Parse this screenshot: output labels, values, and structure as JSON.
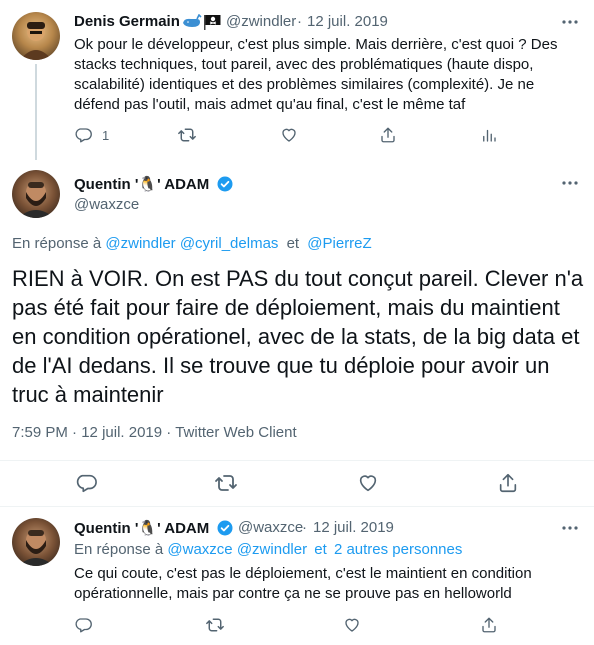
{
  "tweet1": {
    "name": "Denis Germain",
    "handle": "@zwindler",
    "date": "12 juil. 2019",
    "sep": "·",
    "text": "Ok pour le développeur, c'est plus simple. Mais derrière, c'est quoi ? Des stacks techniques, tout pareil, avec des problématiques (haute dispo, scalabilité) identiques et des problèmes similaires (complexité). Je ne défend pas l'outil, mais admet qu'au final, c'est le même taf",
    "reply_count": "1"
  },
  "tweet2": {
    "name": "Quentin '🐧' ADAM",
    "handle": "@waxzce",
    "reply_prefix": "En réponse à",
    "reply_to_1": "@zwindler",
    "reply_to_2": "@cyril_delmas",
    "reply_and": "et",
    "reply_to_3": "@PierreZ",
    "text": "RIEN à VOIR. On est PAS du tout conçut pareil. Clever n'a pas été fait pour faire de déploiement, mais du maintient en condition opérationel, avec de la stats, de la big data et de l'AI dedans. Il se trouve que tu déploie pour avoir un truc à maintenir",
    "meta_time": "7:59 PM",
    "meta_date": "12 juil. 2019",
    "meta_client": "Twitter Web Client",
    "meta_sep": "·"
  },
  "tweet3": {
    "name": "Quentin '🐧' ADAM",
    "handle": "@waxzce",
    "date": "12 juil. 2019",
    "sep": "·",
    "reply_prefix": "En réponse à",
    "reply_to_1": "@waxzce",
    "reply_to_2": "@zwindler",
    "reply_and": "et",
    "reply_to_3": "2 autres personnes",
    "text": "Ce qui coute, c'est pas le déploiement, c'est le maintient en condition opérationnelle, mais par contre ça ne se prouve pas en helloworld"
  },
  "colors": {
    "link": "#1d9bf0",
    "muted": "#536471",
    "verified": "#1d9bf0",
    "divider": "#eff3f4"
  },
  "icons": [
    "reply-icon",
    "retweet-icon",
    "like-icon",
    "share-icon",
    "analytics-icon",
    "more-icon",
    "verified-icon",
    "whale-icon",
    "pirate-flag-icon"
  ]
}
